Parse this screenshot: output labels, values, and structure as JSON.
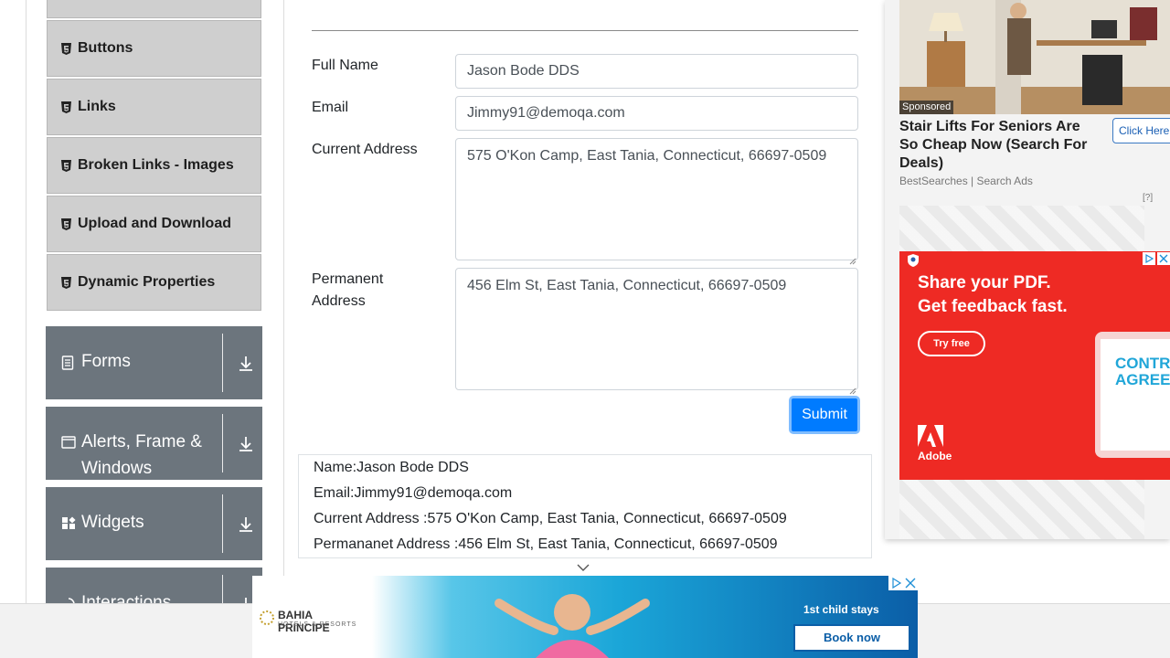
{
  "sidebar": {
    "sub_items": [
      {
        "label": "Buttons",
        "icon": "html5-icon"
      },
      {
        "label": "Links",
        "icon": "html5-icon"
      },
      {
        "label": "Broken Links - Images",
        "icon": "html5-icon"
      },
      {
        "label": "Upload and Download",
        "icon": "html5-icon"
      },
      {
        "label": "Dynamic Properties",
        "icon": "html5-icon"
      }
    ],
    "groups": [
      {
        "label": "Forms",
        "icon": "document-icon"
      },
      {
        "label": "Alerts, Frame &",
        "label2": "Windows",
        "icon": "window-icon"
      },
      {
        "label": "Widgets",
        "icon": "widgets-icon"
      },
      {
        "label": "Interactions",
        "icon": "interactions-icon"
      }
    ]
  },
  "form": {
    "full_name_label": "Full Name",
    "full_name_value": "Jason Bode DDS",
    "email_label": "Email",
    "email_value": "Jimmy91@demoqa.com",
    "current_address_label": "Current Address",
    "current_address_value": "575 O'Kon Camp, East Tania, Connecticut, 66697-0509",
    "permanent_address_label_1": "Permanent",
    "permanent_address_label_2": "Address",
    "permanent_address_value": "456 Elm St, East Tania, Connecticut, 66697-0509",
    "submit_label": "Submit"
  },
  "output": {
    "name": "Name:Jason Bode DDS",
    "email": "Email:Jimmy91@demoqa.com",
    "current_address": "Current Address :575 O'Kon Camp, East Tania, Connecticut, 66697-0509",
    "permanent_address": "Permananet Address :456 Elm St, East Tania, Connecticut, 66697-0509"
  },
  "ads": {
    "stairlift": {
      "sponsored": "Sponsored",
      "title": "Stair Lifts For Seniors Are So Cheap Now (Search For Deals)",
      "source": "BestSearches | Search Ads",
      "button": "Click Here",
      "help": "[?]"
    },
    "adobe": {
      "headline_1": "Share your PDF.",
      "headline_2": "Get feedback fast.",
      "cta": "Try free",
      "doc_title_1": "CONTR",
      "doc_title_2": "AGREE",
      "brand": "Adobe"
    },
    "bahia": {
      "brand": "BAHIA PRINCIPE",
      "sub": "HOTELS & RESORTS",
      "tagline": "1st child stays",
      "cta": "Book now"
    }
  },
  "colors": {
    "primary": "#007bff",
    "sidebar_group": "#6c757d",
    "sidebar_item": "#cfcfcf",
    "adobe_red": "#ee2a24"
  }
}
